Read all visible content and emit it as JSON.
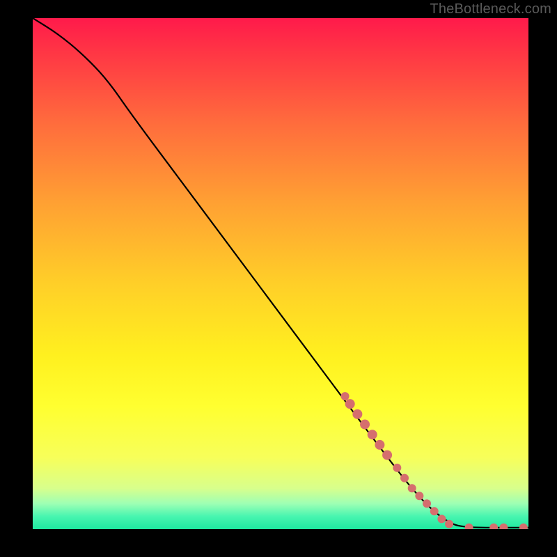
{
  "watermark": "TheBottleneck.com",
  "colors": {
    "frame_bg": "#000000",
    "curve": "#000000",
    "marker_fill": "#d56e6e",
    "marker_stroke": "#c05a5a"
  },
  "chart_data": {
    "type": "line",
    "xlim": [
      0,
      100
    ],
    "ylim": [
      0,
      100
    ],
    "xlabel": "",
    "ylabel": "",
    "title": "",
    "grid": false,
    "curve": [
      {
        "x": 0,
        "y": 100
      },
      {
        "x": 5,
        "y": 97
      },
      {
        "x": 10,
        "y": 93
      },
      {
        "x": 15,
        "y": 88
      },
      {
        "x": 20,
        "y": 81
      },
      {
        "x": 30,
        "y": 68
      },
      {
        "x": 40,
        "y": 55
      },
      {
        "x": 50,
        "y": 42
      },
      {
        "x": 60,
        "y": 29
      },
      {
        "x": 70,
        "y": 16
      },
      {
        "x": 78,
        "y": 6
      },
      {
        "x": 84,
        "y": 1
      },
      {
        "x": 88,
        "y": 0.3
      },
      {
        "x": 95,
        "y": 0.3
      },
      {
        "x": 100,
        "y": 0.3
      }
    ],
    "markers": [
      {
        "x": 63,
        "y": 26,
        "r": 6
      },
      {
        "x": 64,
        "y": 24.5,
        "r": 7
      },
      {
        "x": 65.5,
        "y": 22.5,
        "r": 7
      },
      {
        "x": 67,
        "y": 20.5,
        "r": 7
      },
      {
        "x": 68.5,
        "y": 18.5,
        "r": 7
      },
      {
        "x": 70,
        "y": 16.5,
        "r": 7
      },
      {
        "x": 71.5,
        "y": 14.5,
        "r": 7
      },
      {
        "x": 73.5,
        "y": 12,
        "r": 6
      },
      {
        "x": 75,
        "y": 10,
        "r": 6
      },
      {
        "x": 76.5,
        "y": 8,
        "r": 6
      },
      {
        "x": 78,
        "y": 6.5,
        "r": 6
      },
      {
        "x": 79.5,
        "y": 5,
        "r": 6
      },
      {
        "x": 81,
        "y": 3.5,
        "r": 6
      },
      {
        "x": 82.5,
        "y": 2,
        "r": 6
      },
      {
        "x": 84,
        "y": 1,
        "r": 6
      },
      {
        "x": 88,
        "y": 0.3,
        "r": 6
      },
      {
        "x": 93,
        "y": 0.3,
        "r": 6
      },
      {
        "x": 95,
        "y": 0.3,
        "r": 6
      },
      {
        "x": 99,
        "y": 0.3,
        "r": 6
      }
    ]
  }
}
